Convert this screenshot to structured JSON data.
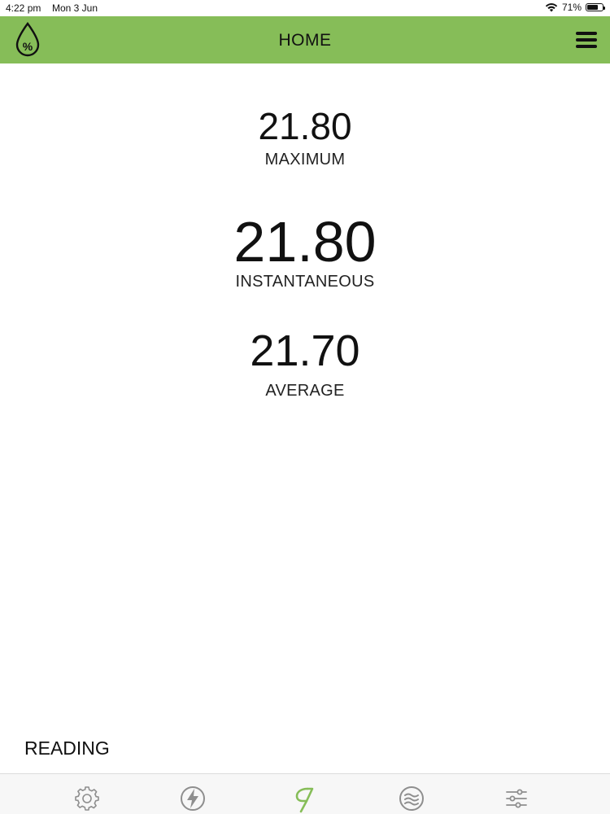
{
  "status_bar": {
    "time": "4:22 pm",
    "date": "Mon 3 Jun",
    "battery": "71%",
    "battery_level": 0.71
  },
  "header": {
    "title": "HOME",
    "logo_icon": "water-drop-percent-icon",
    "menu_icon": "hamburger-menu-icon"
  },
  "readings": {
    "maximum": {
      "value": "21.80",
      "label": "MAXIMUM"
    },
    "instantaneous": {
      "value": "21.80",
      "label": "INSTANTANEOUS"
    },
    "average": {
      "value": "21.70",
      "label": "AVERAGE"
    }
  },
  "mode": {
    "label": "READING"
  },
  "tabs": [
    {
      "icon": "gear-icon",
      "active": false
    },
    {
      "icon": "lightning-icon",
      "active": false
    },
    {
      "icon": "brand-logo-icon",
      "active": true
    },
    {
      "icon": "waves-icon",
      "active": false
    },
    {
      "icon": "sliders-icon",
      "active": false
    }
  ],
  "colors": {
    "header_bg": "#86bd58",
    "active_tab": "#86bd58",
    "inactive_tab": "#8e8e8e"
  }
}
